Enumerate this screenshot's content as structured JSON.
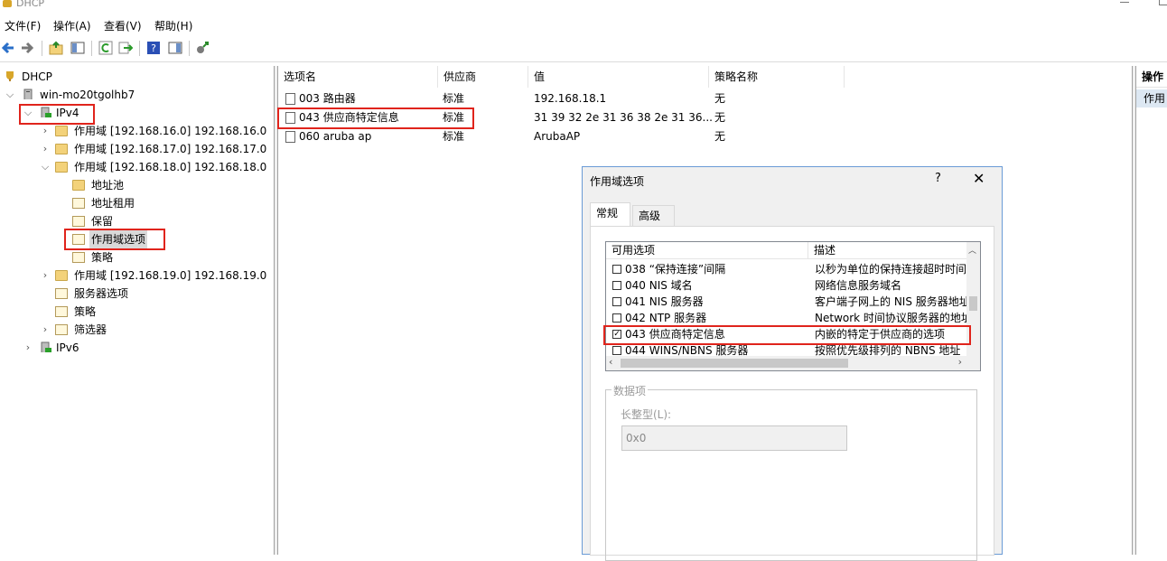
{
  "window": {
    "title": "DHCP"
  },
  "menu": [
    "文件(F)",
    "操作(A)",
    "查看(V)",
    "帮助(H)"
  ],
  "toolbar": [
    "back-icon",
    "forward-icon",
    "up-folder-icon",
    "show-tree-icon",
    "refresh-icon",
    "export-icon",
    "help-icon",
    "properties-icon",
    "plugin-icon"
  ],
  "tree": {
    "root": "DHCP",
    "server": "win-mo20tgolhb7",
    "ipv4": "IPv4",
    "scope16": "作用域 [192.168.16.0] 192.168.16.0",
    "scope17": "作用域 [192.168.17.0] 192.168.17.0",
    "scope18": "作用域 [192.168.18.0] 192.168.18.0",
    "pool": "地址池",
    "leases": "地址租用",
    "reservations": "保留",
    "scope_options": "作用域选项",
    "scope_policies": "策略",
    "scope19": "作用域 [192.168.19.0] 192.168.19.0",
    "server_options": "服务器选项",
    "policies": "策略",
    "filters": "筛选器",
    "ipv6": "IPv6"
  },
  "list": {
    "columns": [
      "选项名",
      "供应商",
      "值",
      "策略名称"
    ],
    "rows": [
      {
        "name": "003 路由器",
        "vendor": "标准",
        "value": "192.168.18.1",
        "policy": "无"
      },
      {
        "name": "043 供应商特定信息",
        "vendor": "标准",
        "value": "31 39 32 2e 31 36 38 2e 31 36...",
        "policy": "无"
      },
      {
        "name": "060 aruba ap",
        "vendor": "标准",
        "value": "ArubaAP",
        "policy": "无"
      }
    ]
  },
  "actions": {
    "header": "操作",
    "item": "作用"
  },
  "dialog": {
    "title": "作用域选项",
    "help": "?",
    "close": "✕",
    "tabs": [
      "常规",
      "高级"
    ],
    "options_columns": [
      "可用选项",
      "描述"
    ],
    "options": [
      {
        "name": "038 “保持连接”间隔",
        "desc": "以秒为单位的保持连接超时时间",
        "checked": false
      },
      {
        "name": "040 NIS 域名",
        "desc": "网络信息服务域名",
        "checked": false
      },
      {
        "name": "041 NIS 服务器",
        "desc": "客户端子网上的 NIS 服务器地址",
        "checked": false
      },
      {
        "name": "042 NTP 服务器",
        "desc": "Network 时间协议服务器的地址",
        "checked": false
      },
      {
        "name": "043 供应商特定信息",
        "desc": "内嵌的特定于供应商的选项",
        "checked": true
      },
      {
        "name": "044 WINS/NBNS 服务器",
        "desc": "按照优先级排列的 NBNS 地址",
        "checked": false
      }
    ],
    "data_group": "数据项",
    "long_label": "长整型(L):",
    "long_value": "0x0"
  }
}
